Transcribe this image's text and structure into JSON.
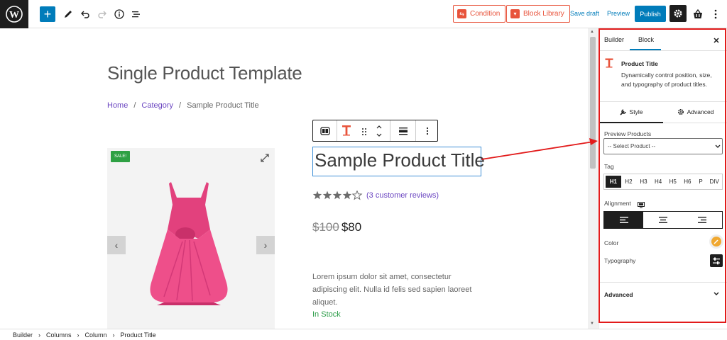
{
  "toolbar": {
    "condition_label": "Condition",
    "block_library_label": "Block Library",
    "save_draft_label": "Save draft",
    "preview_label": "Preview",
    "publish_label": "Publish",
    "accent_color": "#007cba",
    "brand_color": "#e8533b"
  },
  "canvas": {
    "template_title": "Single Product Template",
    "breadcrumb": {
      "home": "Home",
      "sep1": "/",
      "category": "Category",
      "sep2": "/",
      "current": "Sample Product Title"
    },
    "sale_badge": "SALE!",
    "product_title": "Sample Product Title",
    "rating": {
      "value": 4,
      "max": 5,
      "reviews_text": "(3 customer reviews)"
    },
    "price": {
      "old": "$100",
      "new": "$80"
    },
    "description": "Lorem ipsum dolor sit amet, consectetur adipiscing elit. Nulla id felis sed sapien laoreet aliquet.",
    "stock": "In Stock"
  },
  "bottombar": {
    "crumbs": [
      "Builder",
      "Columns",
      "Column",
      "Product Title"
    ]
  },
  "sidebar": {
    "tab_builder": "Builder",
    "tab_block": "Block",
    "block_name": "Product Title",
    "block_desc": "Dynamically control position, size, and typography of product titles.",
    "style_tab": "Style",
    "advanced_tab": "Advanced",
    "preview_products_label": "Preview Products",
    "select_value": "-- Select Product --",
    "tag_label": "Tag",
    "tags": [
      "H1",
      "H2",
      "H3",
      "H4",
      "H5",
      "H6",
      "P",
      "DIV"
    ],
    "tag_selected": "H1",
    "alignment_label": "Alignment",
    "color_label": "Color",
    "typography_label": "Typography",
    "advanced_label": "Advanced"
  }
}
